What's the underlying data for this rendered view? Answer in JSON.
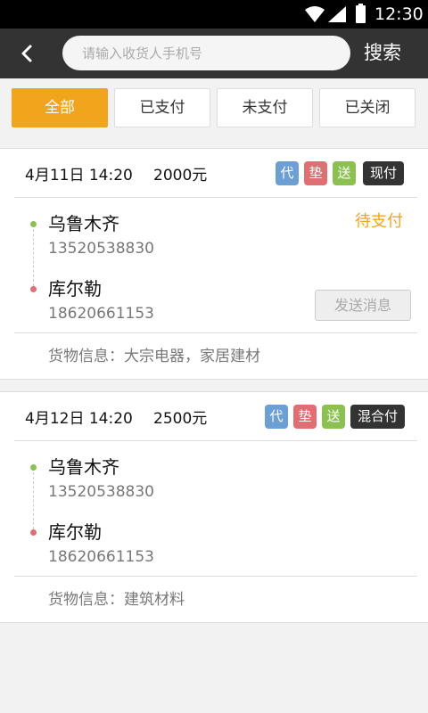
{
  "status_bar": {
    "time": "12:30"
  },
  "header": {
    "search_placeholder": "请输入收货人手机号",
    "search_button": "搜索"
  },
  "filter_tabs": [
    {
      "label": "全部",
      "active": true
    },
    {
      "label": "已支付",
      "active": false
    },
    {
      "label": "未支付",
      "active": false
    },
    {
      "label": "已关闭",
      "active": false
    }
  ],
  "orders": [
    {
      "date": "4月11日 14:20",
      "amount": "2000元",
      "tags": [
        "代",
        "垫",
        "送"
      ],
      "payment": "现付",
      "from": {
        "city": "乌鲁木齐",
        "phone": "13520538830"
      },
      "to": {
        "city": "库尔勒",
        "phone": "18620661153"
      },
      "status": "待支付",
      "action": "发送消息",
      "goods": "货物信息：大宗电器，家居建材"
    },
    {
      "date": "4月12日 14:20",
      "amount": "2500元",
      "tags": [
        "代",
        "垫",
        "送"
      ],
      "payment": "混合付",
      "from": {
        "city": "乌鲁木齐",
        "phone": "13520538830"
      },
      "to": {
        "city": "库尔勒",
        "phone": "18620661153"
      },
      "goods": "货物信息：建筑材料"
    }
  ]
}
